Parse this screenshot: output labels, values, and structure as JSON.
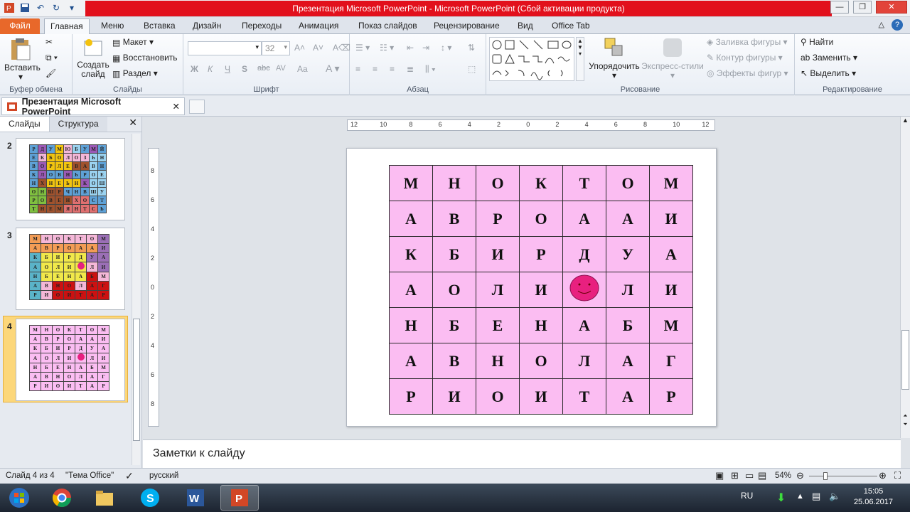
{
  "window": {
    "title": "Презентация Microsoft PowerPoint  -  Microsoft PowerPoint (Сбой активации продукта)"
  },
  "ribbon_tabs": [
    "Файл",
    "Главная",
    "Меню",
    "Вставка",
    "Дизайн",
    "Переходы",
    "Анимация",
    "Показ слайдов",
    "Рецензирование",
    "Вид",
    "Office Tab"
  ],
  "ribbon": {
    "clipboard": {
      "paste": "Вставить",
      "label": "Буфер обмена"
    },
    "slides": {
      "new_slide": "Создать слайд",
      "layout": "Макет",
      "reset": "Восстановить",
      "section": "Раздел",
      "label": "Слайды"
    },
    "font": {
      "size": "32",
      "label": "Шрифт",
      "bold": "Ж",
      "italic": "К",
      "underline": "Ч",
      "strike": "S",
      "abc": "abc",
      "spacing": "AV",
      "case": "Aa"
    },
    "paragraph": {
      "label": "Абзац"
    },
    "drawing": {
      "arrange": "Упорядочить",
      "quick_styles": "Экспресс-стили",
      "fill": "Заливка фигуры",
      "outline": "Контур фигуры",
      "effects": "Эффекты фигур",
      "label": "Рисование"
    },
    "editing": {
      "find": "Найти",
      "replace": "Заменить",
      "select": "Выделить",
      "label": "Редактирование"
    }
  },
  "doc_tab": {
    "name": "Презентация Microsoft PowerPoint"
  },
  "panel": {
    "tab_slides": "Слайды",
    "tab_outline": "Структура"
  },
  "thumbnails": [
    {
      "num": "2",
      "rows": [
        [
          "Р",
          "Д",
          "У",
          "М",
          "Ю",
          "Б",
          "У",
          "М",
          "Й"
        ],
        [
          "Е",
          "К",
          "Б",
          "О",
          "Л",
          "О",
          "З",
          "Ь",
          "Н"
        ],
        [
          "В",
          "О",
          "Р",
          "Л",
          "Е",
          "В",
          "А",
          "В",
          "Н"
        ],
        [
          "К",
          "Л",
          "О",
          "В",
          "Н",
          "Ь",
          "Р",
          "О",
          "Е"
        ],
        [
          "Н",
          "Х",
          "Н",
          "Е",
          "Ь",
          "Н",
          "К",
          "О",
          "Ш"
        ],
        [
          "О",
          "Н",
          "Ш",
          "Р",
          "Ч",
          "Н",
          "В",
          "Ш",
          "У"
        ],
        [
          "Р",
          "О",
          "В",
          "Е",
          "Н",
          "Х",
          "О",
          "С",
          "Т"
        ],
        [
          "Т",
          "Н",
          "Е",
          "М",
          "Я",
          "Н",
          "Т",
          "С",
          "Ь"
        ]
      ]
    },
    {
      "num": "3",
      "rows": [
        [
          "М",
          "Н",
          "О",
          "К",
          "Т",
          "О",
          "М"
        ],
        [
          "А",
          "В",
          "Р",
          "О",
          "А",
          "А",
          "И"
        ],
        [
          "К",
          "Б",
          "И",
          "Р",
          "Д",
          "У",
          "А"
        ],
        [
          "А",
          "О",
          "Л",
          "И",
          "",
          "Л",
          "И"
        ],
        [
          "Н",
          "Б",
          "Е",
          "Н",
          "А",
          "Б",
          "М"
        ],
        [
          "А",
          "В",
          "Н",
          "О",
          "Л",
          "А",
          "Г"
        ],
        [
          "Р",
          "И",
          "О",
          "И",
          "Т",
          "А",
          "Р"
        ]
      ]
    },
    {
      "num": "4",
      "rows": [
        [
          "М",
          "Н",
          "О",
          "К",
          "Т",
          "О",
          "М"
        ],
        [
          "А",
          "В",
          "Р",
          "О",
          "А",
          "А",
          "И"
        ],
        [
          "К",
          "Б",
          "И",
          "Р",
          "Д",
          "У",
          "А"
        ],
        [
          "А",
          "О",
          "Л",
          "И",
          "",
          "Л",
          "И"
        ],
        [
          "Н",
          "Б",
          "Е",
          "Н",
          "А",
          "Б",
          "М"
        ],
        [
          "А",
          "В",
          "Н",
          "О",
          "Л",
          "А",
          "Г"
        ],
        [
          "Р",
          "И",
          "О",
          "И",
          "Т",
          "А",
          "Р"
        ]
      ]
    }
  ],
  "ruler": {
    "h_ticks": [
      "12",
      "10",
      "8",
      "6",
      "4",
      "2",
      "0",
      "2",
      "4",
      "6",
      "8",
      "10",
      "12"
    ],
    "v_ticks": [
      "8",
      "6",
      "4",
      "2",
      "0",
      "2",
      "4",
      "6",
      "8"
    ]
  },
  "slide": {
    "grid": [
      [
        "М",
        "Н",
        "О",
        "К",
        "Т",
        "О",
        "М"
      ],
      [
        "А",
        "В",
        "Р",
        "О",
        "А",
        "А",
        "И"
      ],
      [
        "К",
        "Б",
        "И",
        "Р",
        "Д",
        "У",
        "А"
      ],
      [
        "А",
        "О",
        "Л",
        "И",
        "",
        "Л",
        "И"
      ],
      [
        "Н",
        "Б",
        "Е",
        "Н",
        "А",
        "Б",
        "М"
      ],
      [
        "А",
        "В",
        "Н",
        "О",
        "Л",
        "А",
        "Г"
      ],
      [
        "Р",
        "И",
        "О",
        "И",
        "Т",
        "А",
        "Р"
      ]
    ],
    "cell_color": "#fbbdf2",
    "smiley_color": "#e8207f"
  },
  "notes": {
    "placeholder": "Заметки к слайду"
  },
  "status": {
    "slide": "Слайд 4 из 4",
    "theme": "\"Тема Office\"",
    "lang": "русский",
    "zoom": "54%"
  },
  "taskbar": {
    "lang": "RU",
    "time": "15:05",
    "date": "25.06.2017"
  }
}
